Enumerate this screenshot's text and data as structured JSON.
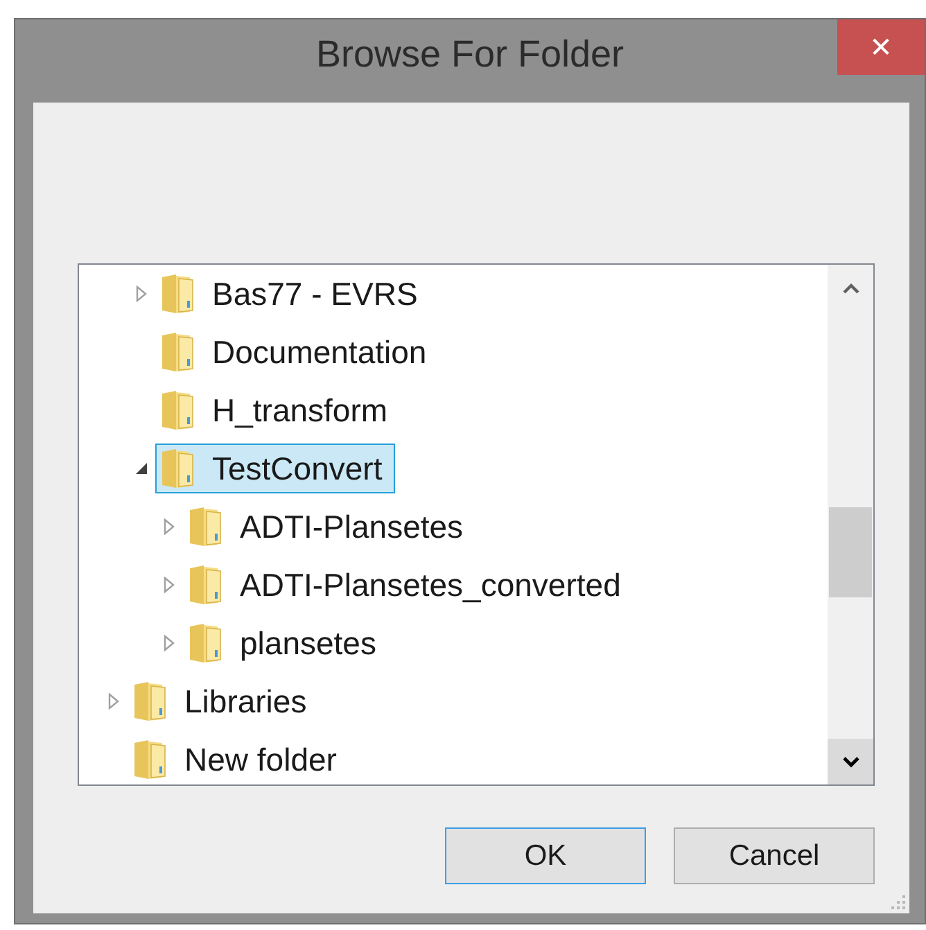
{
  "window": {
    "title": "Browse For Folder",
    "close": "✕"
  },
  "tree": {
    "items": [
      {
        "children": [
          {
            "label": "Bas77 - EVRS",
            "expandable": true,
            "expanded": false,
            "selected": false
          },
          {
            "label": "Documentation",
            "expandable": false,
            "selected": false
          },
          {
            "label": "H_transform",
            "expandable": false,
            "selected": false
          },
          {
            "label": "TestConvert",
            "expandable": true,
            "expanded": true,
            "selected": true,
            "children": [
              {
                "label": "ADTI-Plansetes",
                "expandable": true,
                "expanded": false,
                "selected": false
              },
              {
                "label": "ADTI-Plansetes_converted",
                "expandable": true,
                "expanded": false,
                "selected": false
              },
              {
                "label": "plansetes",
                "expandable": true,
                "expanded": false,
                "selected": false
              }
            ]
          }
        ]
      },
      {
        "label": "Libraries",
        "expandable": true,
        "expanded": false,
        "selected": false
      },
      {
        "label": "New folder",
        "expandable": false,
        "selected": false
      }
    ]
  },
  "buttons": [
    {
      "label": "OK",
      "default": true
    },
    {
      "label": "Cancel",
      "default": false
    }
  ]
}
